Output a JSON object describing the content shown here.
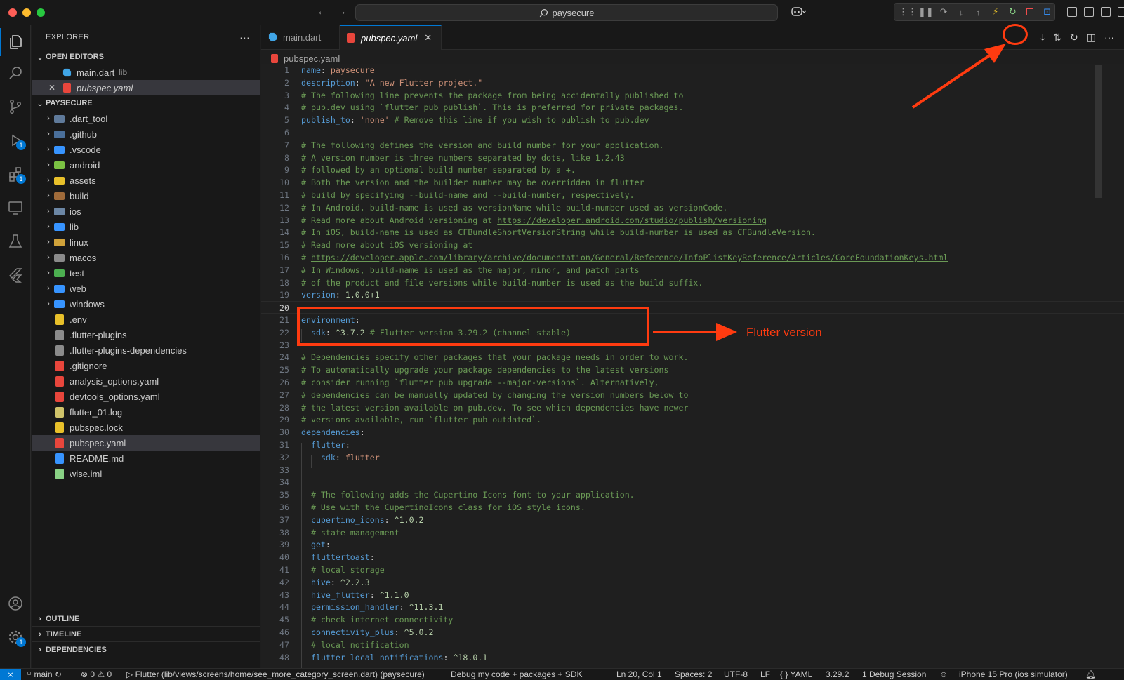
{
  "titlebar": {
    "search_text": "paysecure"
  },
  "explorer": {
    "title": "EXPLORER",
    "more": "···",
    "open_editors_label": "OPEN EDITORS",
    "open_editors": [
      {
        "name": "main.dart",
        "desc": "lib"
      },
      {
        "name": "pubspec.yaml",
        "desc": ""
      }
    ],
    "project_label": "PAYSECURE",
    "folders": [
      ".dart_tool",
      ".github",
      ".vscode",
      "android",
      "assets",
      "build",
      "ios",
      "lib",
      "linux",
      "macos",
      "test",
      "web",
      "windows"
    ],
    "files": [
      ".env",
      ".flutter-plugins",
      ".flutter-plugins-dependencies",
      ".gitignore",
      "analysis_options.yaml",
      "devtools_options.yaml",
      "flutter_01.log",
      "pubspec.lock",
      "pubspec.yaml",
      "README.md",
      "wise.iml"
    ],
    "bottom_sections": [
      "OUTLINE",
      "TIMELINE",
      "DEPENDENCIES"
    ]
  },
  "activity_badges": {
    "debug": "1",
    "extensions": "1",
    "settings": "1"
  },
  "tabs": [
    {
      "label": "main.dart"
    },
    {
      "label": "pubspec.yaml",
      "close": "✕"
    }
  ],
  "breadcrumb": "pubspec.yaml",
  "code_lines": [
    "name: paysecure",
    "description: \"A new Flutter project.\"",
    "# The following line prevents the package from being accidentally published to",
    "# pub.dev using `flutter pub publish`. This is preferred for private packages.",
    "publish_to: 'none' # Remove this line if you wish to publish to pub.dev",
    "",
    "# The following defines the version and build number for your application.",
    "# A version number is three numbers separated by dots, like 1.2.43",
    "# followed by an optional build number separated by a +.",
    "# Both the version and the builder number may be overridden in flutter",
    "# build by specifying --build-name and --build-number, respectively.",
    "# In Android, build-name is used as versionName while build-number used as versionCode.",
    "# Read more about Android versioning at https://developer.android.com/studio/publish/versioning",
    "# In iOS, build-name is used as CFBundleShortVersionString while build-number is used as CFBundleVersion.",
    "# Read more about iOS versioning at",
    "# https://developer.apple.com/library/archive/documentation/General/Reference/InfoPlistKeyReference/Articles/CoreFoundationKeys.html",
    "# In Windows, build-name is used as the major, minor, and patch parts",
    "# of the product and file versions while build-number is used as the build suffix.",
    "version: 1.0.0+1",
    "",
    "environment:",
    "  sdk: ^3.7.2 # Flutter version 3.29.2 (channel stable)",
    "",
    "# Dependencies specify other packages that your package needs in order to work.",
    "# To automatically upgrade your package dependencies to the latest versions",
    "# consider running `flutter pub upgrade --major-versions`. Alternatively,",
    "# dependencies can be manually updated by changing the version numbers below to",
    "# the latest version available on pub.dev. To see which dependencies have newer",
    "# versions available, run `flutter pub outdated`.",
    "dependencies:",
    "  flutter:",
    "    sdk: flutter",
    "",
    "",
    "  # The following adds the Cupertino Icons font to your application.",
    "  # Use with the CupertinoIcons class for iOS style icons.",
    "  cupertino_icons: ^1.0.2",
    "  # state management",
    "  get:",
    "  fluttertoast:",
    "  # local storage",
    "  hive: ^2.2.3",
    "  hive_flutter: ^1.1.0",
    "  permission_handler: ^11.3.1",
    "  # check internet connectivity",
    "  connectivity_plus: ^5.0.2",
    "  # local notification",
    "  flutter_local_notifications: ^18.0.1"
  ],
  "current_line": 20,
  "annotation_label": "Flutter version",
  "statusbar": {
    "remote": "⨯",
    "branch": "main",
    "problems": "⊗ 0 ⚠ 0",
    "flutter_target": "Flutter (lib/views/screens/home/see_more_category_screen.dart) (paysecure)",
    "debug_mode": "Debug my code + packages + SDK",
    "cursor": "Ln 20, Col 1",
    "spaces": "Spaces: 2",
    "encoding": "UTF-8",
    "eol": "LF",
    "language": "{ } YAML",
    "sdk_version": "3.29.2",
    "sessions": "1 Debug Session",
    "device": "iPhone 15 Pro (ios simulator)"
  },
  "colors": {
    "accent": "#0078d4",
    "annotation": "#ff3b10",
    "comment": "#6a9955",
    "key": "#569cd6",
    "string": "#ce9178"
  }
}
